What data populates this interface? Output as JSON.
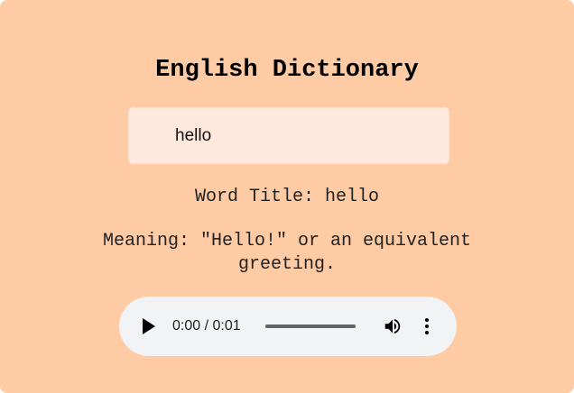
{
  "app": {
    "title": "English Dictionary"
  },
  "search": {
    "value": "hello"
  },
  "result": {
    "word_title": "Word Title: hello",
    "meaning": "Meaning: \"Hello!\" or an equivalent greeting."
  },
  "audio_player": {
    "time": "0:00 / 0:01",
    "progress_fraction": 0,
    "icons": {
      "play": "play-icon",
      "volume": "volume-icon",
      "more": "more-options-icon"
    }
  },
  "colors": {
    "background": "#ffcba4",
    "input_background": "#ffe9dc",
    "player_background": "#f1f3f4"
  }
}
